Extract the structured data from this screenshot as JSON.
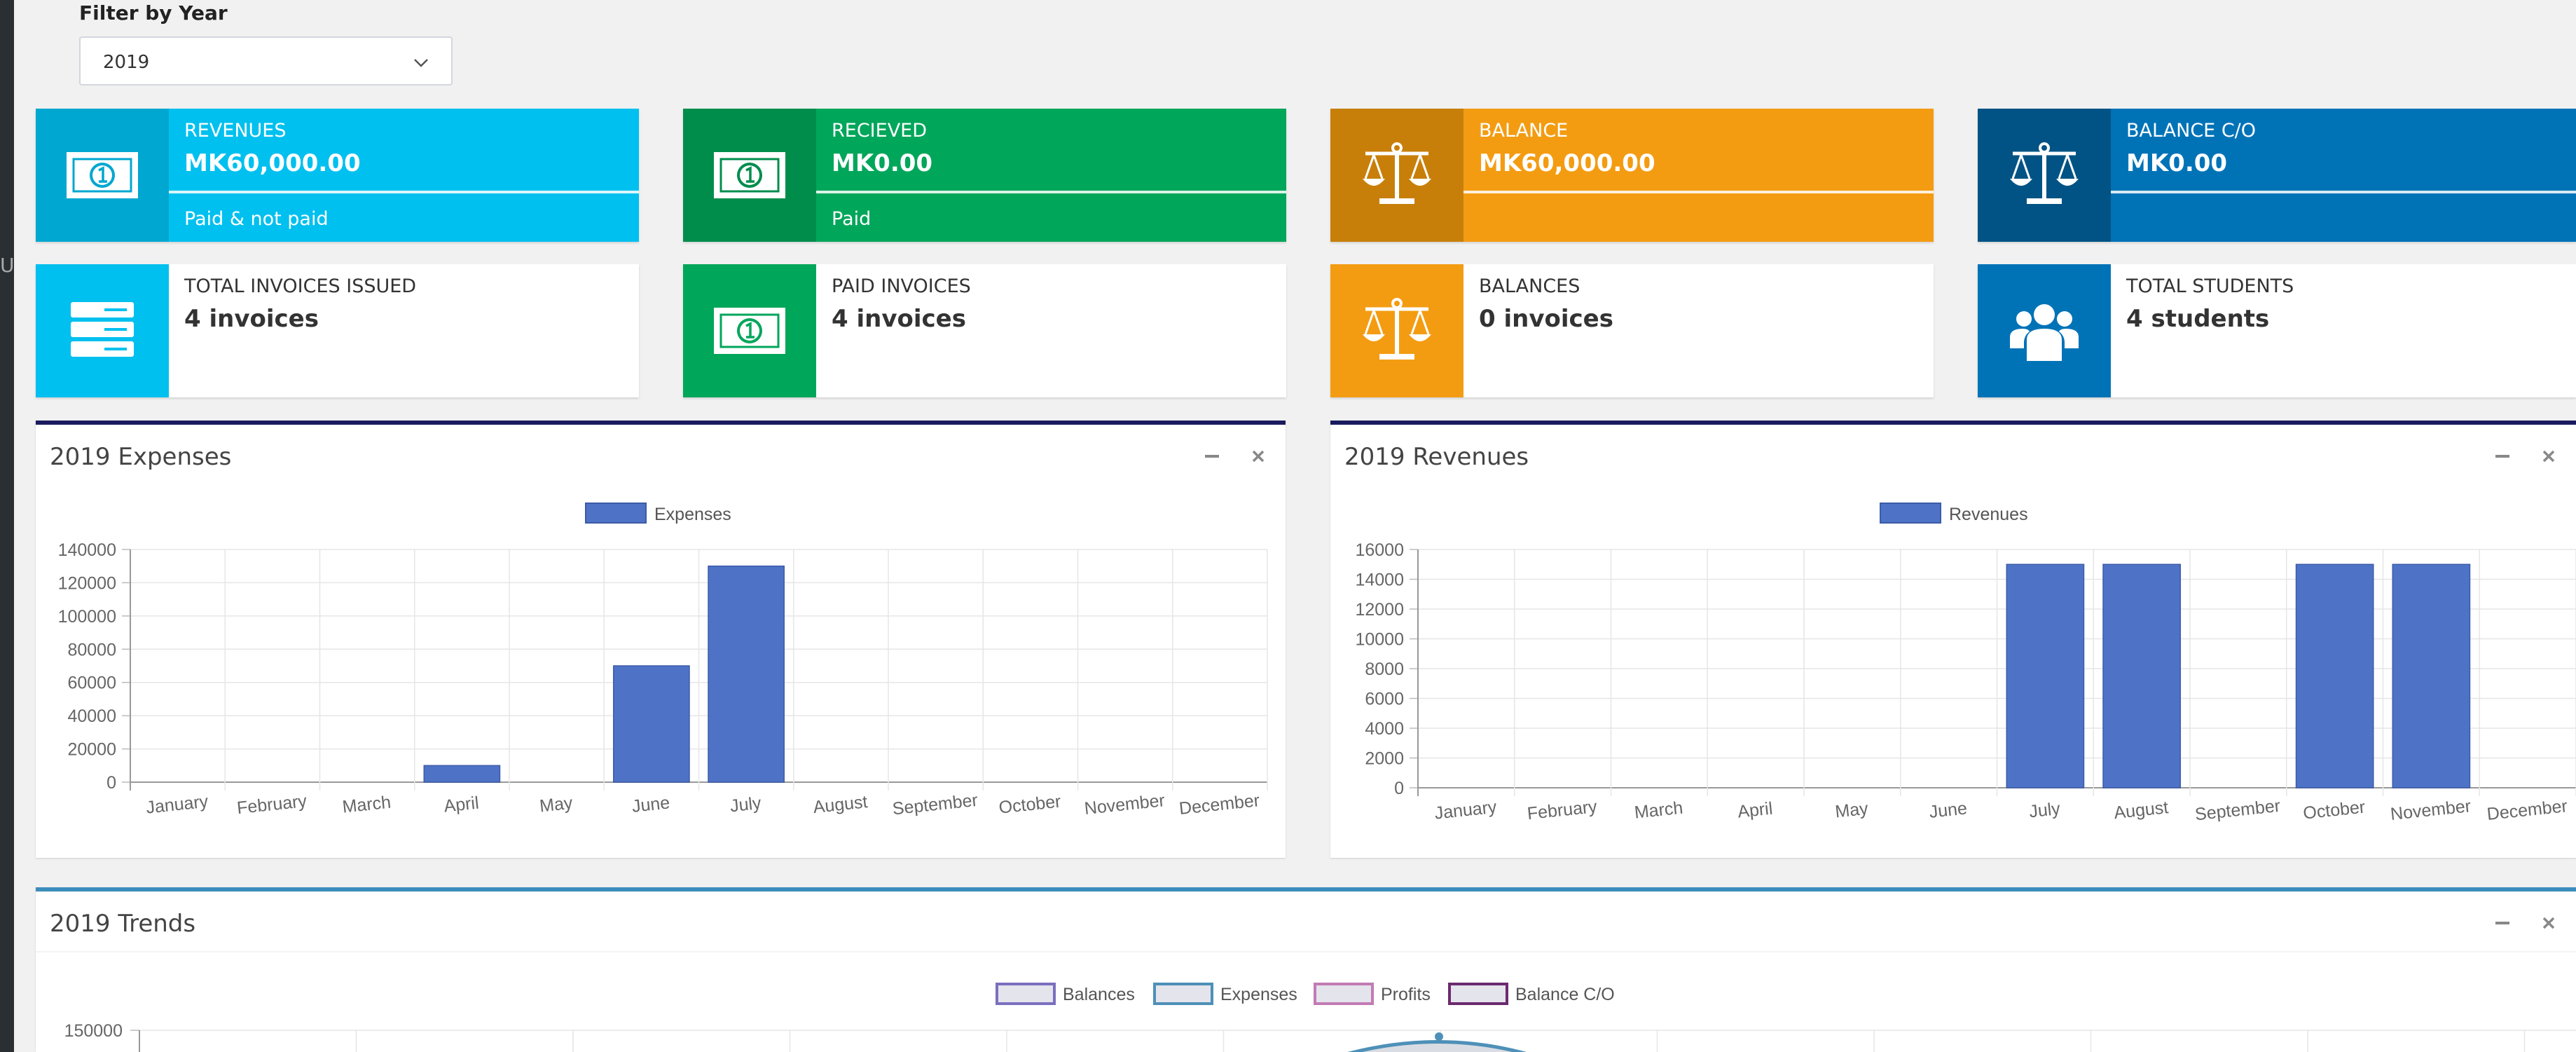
{
  "sidebar": {
    "edge_glyph": "U"
  },
  "filter": {
    "label": "Filter by Year",
    "value": "2019"
  },
  "info_boxes": [
    {
      "key": "revenues",
      "text": "REVENUES",
      "number": "MK60,000.00",
      "desc": "Paid & not paid",
      "icon": "money-icon",
      "color": "#00c0ef",
      "icon_color": "#00a7d0"
    },
    {
      "key": "received",
      "text": "RECIEVED",
      "number": "MK0.00",
      "desc": "Paid",
      "icon": "money-icon",
      "color": "#00a65a",
      "icon_color": "#008d4c"
    },
    {
      "key": "balance",
      "text": "BALANCE",
      "number": "MK60,000.00",
      "desc": "",
      "icon": "balance-scale-icon",
      "color": "#f39c12",
      "icon_color": "#c87f0a"
    },
    {
      "key": "balance-co",
      "text": "BALANCE C/O",
      "number": "MK0.00",
      "desc": "",
      "icon": "balance-scale-icon",
      "color": "#0073b7",
      "icon_color": "#005384"
    },
    {
      "key": "total-invoices",
      "text": "TOTAL INVOICES ISSUED",
      "number": "4 invoices",
      "icon": "server-icon",
      "color": "#ffffff",
      "icon_color": "#00c0ef"
    },
    {
      "key": "paid-invoices",
      "text": "PAID INVOICES",
      "number": "4 invoices",
      "icon": "money-icon",
      "color": "#ffffff",
      "icon_color": "#00a65a"
    },
    {
      "key": "balances",
      "text": "BALANCES",
      "number": "0 invoices",
      "icon": "balance-scale-icon",
      "color": "#ffffff",
      "icon_color": "#f39c12"
    },
    {
      "key": "total-students",
      "text": "TOTAL STUDENTS",
      "number": "4 students",
      "icon": "users-icon",
      "color": "#ffffff",
      "icon_color": "#0073b7"
    }
  ],
  "boxes": {
    "expenses": {
      "title": "2019 Expenses",
      "border_color": "#1a1a5e"
    },
    "revenues": {
      "title": "2019 Revenues",
      "border_color": "#1a1a5e"
    },
    "trends": {
      "title": "2019 Trends",
      "border_color": "#3c8dbc"
    }
  },
  "chart_data": [
    {
      "type": "bar",
      "categories": [
        "January",
        "February",
        "March",
        "April",
        "May",
        "June",
        "July",
        "August",
        "September",
        "October",
        "November",
        "December"
      ],
      "series": [
        {
          "name": "Expenses",
          "values": [
            0,
            0,
            0,
            10000,
            0,
            70000,
            130000,
            0,
            0,
            0,
            0,
            0
          ],
          "color": "#4e73c6"
        }
      ],
      "yticks": [
        "0",
        "20000",
        "40000",
        "60000",
        "80000",
        "100000",
        "120000",
        "140000"
      ],
      "ylim": [
        0,
        140000
      ],
      "grid": true,
      "legend": "top-center"
    },
    {
      "type": "bar",
      "categories": [
        "January",
        "February",
        "March",
        "April",
        "May",
        "June",
        "July",
        "August",
        "September",
        "October",
        "November",
        "December"
      ],
      "series": [
        {
          "name": "Revenues",
          "values": [
            0,
            0,
            0,
            0,
            0,
            0,
            15000,
            15000,
            0,
            15000,
            15000,
            0
          ],
          "color": "#4e73c6"
        }
      ],
      "yticks": [
        "0",
        "2000",
        "4000",
        "6000",
        "8000",
        "10000",
        "12000",
        "14000",
        "16000"
      ],
      "ylim": [
        0,
        16000
      ],
      "grid": true,
      "legend": "top-center"
    },
    {
      "type": "line",
      "series": [
        {
          "name": "Balances",
          "color": "#7b6fbf"
        },
        {
          "name": "Expenses",
          "color": "#4e90b8"
        },
        {
          "name": "Profits",
          "color": "#c27bb4"
        },
        {
          "name": "Balance C/O",
          "color": "#6b2a6f"
        }
      ],
      "yticks": [
        "150000"
      ],
      "grid": true,
      "legend": "top-center"
    }
  ]
}
